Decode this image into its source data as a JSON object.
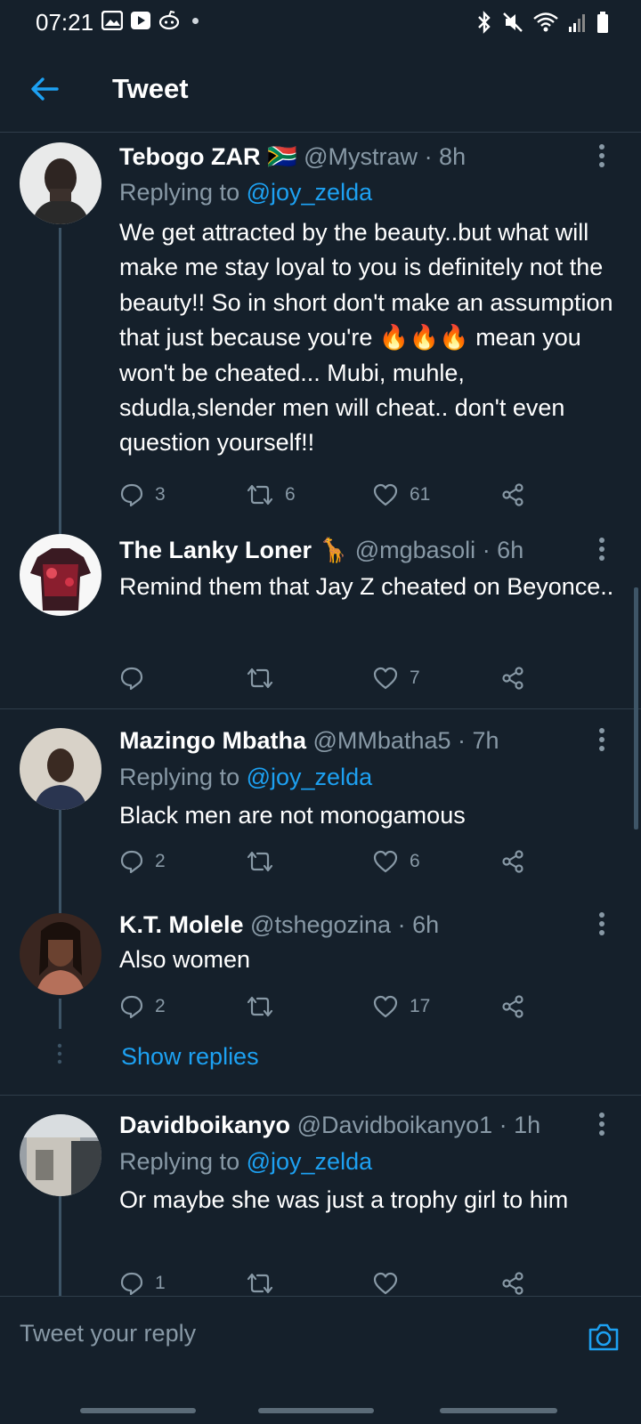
{
  "status_bar": {
    "time": "07:21"
  },
  "header": {
    "title": "Tweet"
  },
  "tweets": [
    {
      "name": "Tebogo ZAR",
      "flag": "🇿🇦",
      "handle": "@Mystraw",
      "time": "· 8h",
      "replying_prefix": "Replying to",
      "replying_to": "@joy_zelda",
      "text": "We get attracted by the beauty..but what will make me stay loyal to you is definitely not the beauty!! So in short don't make an assumption that just because you're 🔥🔥🔥 mean you won't be cheated... Mubi, muhle, sdudla,slender men will cheat.. don't even question yourself!!",
      "replies": "3",
      "retweets": "6",
      "likes": "61"
    },
    {
      "name": "The Lanky Loner",
      "flag": "🦒",
      "handle": "@mgbasoli",
      "time": "· 6h",
      "text": "Remind them that Jay Z cheated on Beyonce..",
      "replies": "",
      "retweets": "",
      "likes": "7"
    },
    {
      "name": "Mazingo Mbatha",
      "handle": "@MMbatha5",
      "time": "· 7h",
      "replying_prefix": "Replying to",
      "replying_to": "@joy_zelda",
      "text": "Black men are not monogamous",
      "replies": "2",
      "retweets": "",
      "likes": "6"
    },
    {
      "name": "K.T. Molele",
      "handle": "@tshegozina",
      "time": "· 6h",
      "text": "Also women",
      "replies": "2",
      "retweets": "",
      "likes": "17"
    },
    {
      "name": "Davidboikanyo",
      "handle": "@Davidboikanyo1",
      "time": "· 1h",
      "replying_prefix": "Replying to",
      "replying_to": "@joy_zelda",
      "text": "Or maybe she was just a trophy girl to him",
      "replies": "1",
      "retweets": "",
      "likes": ""
    }
  ],
  "show_replies": "Show replies",
  "reply_bar": {
    "placeholder": "Tweet your reply"
  },
  "colors": {
    "background": "#15202b",
    "accent": "#1da1f2",
    "muted": "#8899a6",
    "divider": "#2f3d4a"
  }
}
